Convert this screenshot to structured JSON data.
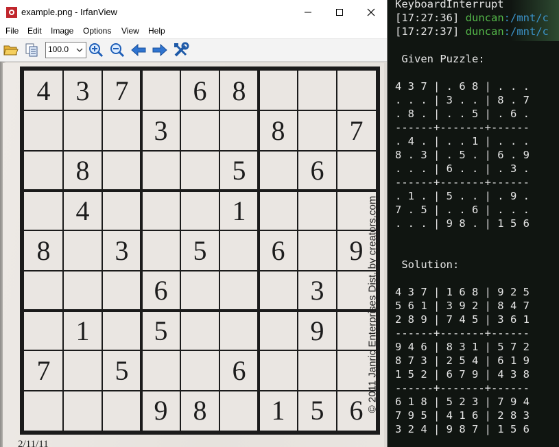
{
  "irfanview": {
    "title": "example.png - IrfanView",
    "menu": [
      "File",
      "Edit",
      "Image",
      "Options",
      "View",
      "Help"
    ],
    "zoom_value": "100.0",
    "toolbar_icons": [
      "open-folder-icon",
      "copy-icon",
      "zoom-in-icon",
      "zoom-out-icon",
      "previous-arrow-icon",
      "next-arrow-icon",
      "settings-tools-icon"
    ],
    "photo": {
      "grid": [
        [
          "4",
          "3",
          "7",
          "",
          "6",
          "8",
          "",
          "",
          ""
        ],
        [
          "",
          "",
          "",
          "3",
          "",
          "",
          "8",
          "",
          "7"
        ],
        [
          "",
          "8",
          "",
          "",
          "",
          "5",
          "",
          "6",
          ""
        ],
        [
          "",
          "4",
          "",
          "",
          "",
          "1",
          "",
          "",
          ""
        ],
        [
          "8",
          "",
          "3",
          "",
          "5",
          "",
          "6",
          "",
          "9"
        ],
        [
          "",
          "",
          "",
          "6",
          "",
          "",
          "",
          "3",
          ""
        ],
        [
          "",
          "1",
          "",
          "5",
          "",
          "",
          "",
          "9",
          ""
        ],
        [
          "7",
          "",
          "5",
          "",
          "",
          "6",
          "",
          "",
          ""
        ],
        [
          "",
          "",
          "",
          "9",
          "8",
          "",
          "1",
          "5",
          "6"
        ]
      ],
      "side_text": "© 2011 Janric Enterprises Dist. by creators.com",
      "date": "2/11/11"
    }
  },
  "terminal": {
    "lines": [
      "KeyboardInterrupt",
      "",
      "",
      "",
      " Given Puzzle:",
      "",
      "4 3 7 | . 6 8 | . . .",
      ". . . | 3 . . | 8 . 7",
      ". 8 . | . . 5 | . 6 .",
      "------+-------+------",
      ". 4 . | . . 1 | . . .",
      "8 . 3 | . 5 . | 6 . 9",
      ". . . | 6 . . | . 3 .",
      "------+-------+------",
      ". 1 . | 5 . . | . 9 .",
      "7 . 5 | . . 6 | . . .",
      ". . . | 9 8 . | 1 5 6",
      "",
      "",
      " Solution:",
      "",
      "4 3 7 | 1 6 8 | 9 2 5",
      "5 6 1 | 3 9 2 | 8 4 7",
      "2 8 9 | 7 4 5 | 3 6 1",
      "------+-------+------",
      "9 4 6 | 8 3 1 | 5 7 2",
      "8 7 3 | 2 5 4 | 6 1 9",
      "1 5 2 | 6 7 9 | 4 3 8",
      "------+-------+------",
      "6 1 8 | 5 2 3 | 7 9 4",
      "7 9 5 | 4 1 6 | 2 8 3",
      "3 2 4 | 9 8 7 | 1 5 6"
    ],
    "prompts": [
      {
        "time": "[17:27:36]",
        "user": "duncan",
        "path": ":/mnt/c"
      },
      {
        "time": "[17:27:37]",
        "user": "duncan",
        "path": ":/mnt/c"
      }
    ],
    "colors": {
      "background": "#101511",
      "user": "#55b94a",
      "path": "#3b93c9",
      "text": "#e6e6e6"
    }
  }
}
